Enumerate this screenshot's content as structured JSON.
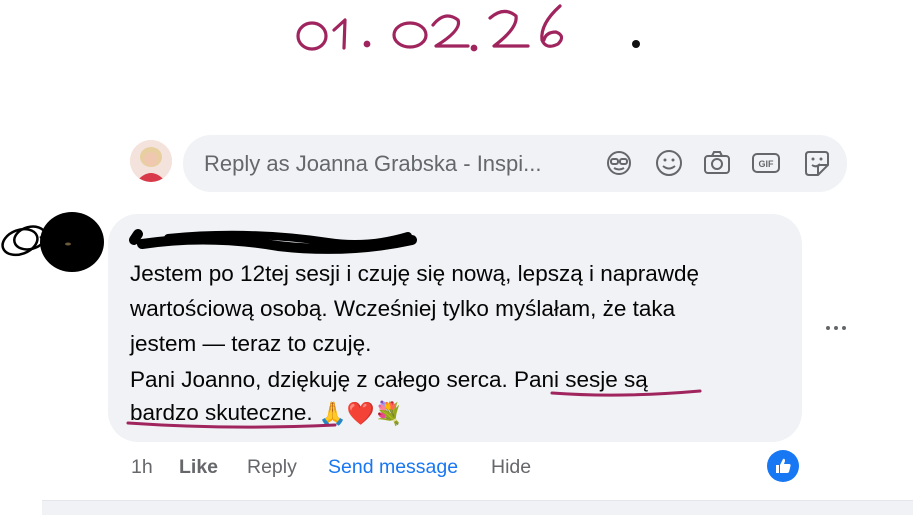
{
  "annotation": {
    "date_text": "01.02.26",
    "color": "#a0245e"
  },
  "reply_composer": {
    "placeholder": "Reply as Joanna Grabska - Inspi...",
    "icons": [
      "sticker-face-icon",
      "emoji-icon",
      "camera-icon",
      "gif-icon",
      "sticker-icon"
    ],
    "gif_label": "GIF"
  },
  "comment": {
    "author_redacted": true,
    "lines": [
      "Jestem po 12tej sesji i czuję się nową, lepszą i naprawdę",
      "wartościową osobą. Wcześniej tylko myślałam, że taka",
      "jestem — teraz to czuję.",
      "Pani Joanno, dziękuję z całego serca. Pani sesje są",
      "bardzo skuteczne."
    ],
    "emojis": [
      "🙏",
      "❤️",
      "💐"
    ]
  },
  "actions": {
    "time": "1h",
    "like": "Like",
    "reply": "Reply",
    "send_message": "Send message",
    "hide": "Hide"
  },
  "colors": {
    "link": "#1877f2",
    "bubble": "#f0f2f5",
    "muted": "#65676b",
    "underline": "#a0245e"
  }
}
